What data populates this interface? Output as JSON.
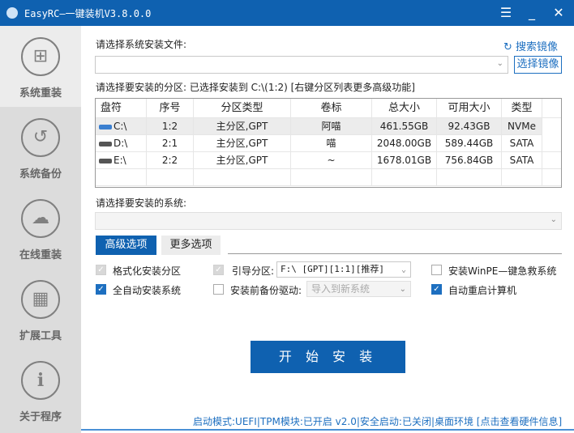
{
  "window": {
    "title": "EasyRC—一键装机V3.8.0.0",
    "menu_icon": "menu-icon",
    "minimize_icon": "minimize-icon",
    "close_icon": "close-icon"
  },
  "sidebar": {
    "items": [
      {
        "label": "系统重装",
        "icon": "windows-icon",
        "active": true
      },
      {
        "label": "系统备份",
        "icon": "backup-icon"
      },
      {
        "label": "在线重装",
        "icon": "cloud-sync-icon"
      },
      {
        "label": "扩展工具",
        "icon": "tools-icon"
      },
      {
        "label": "关于程序",
        "icon": "info-icon"
      }
    ]
  },
  "image": {
    "label": "请选择系统安装文件:",
    "search_label": "搜索镜像",
    "value": "",
    "select_button": "选择镜像"
  },
  "partition": {
    "label": "请选择要安装的分区: 已选择安装到 C:\\(1:2) [右键分区列表更多高级功能]",
    "columns": [
      "盘符",
      "序号",
      "分区类型",
      "卷标",
      "总大小",
      "可用大小",
      "类型"
    ],
    "rows": [
      [
        "C:\\",
        "1:2",
        "主分区,GPT",
        "阿喵",
        "461.55GB",
        "92.43GB",
        "NVMe"
      ],
      [
        "D:\\",
        "2:1",
        "主分区,GPT",
        "喵",
        "2048.00GB",
        "589.44GB",
        "SATA"
      ],
      [
        "E:\\",
        "2:2",
        "主分区,GPT",
        "~",
        "1678.01GB",
        "756.84GB",
        "SATA"
      ]
    ]
  },
  "system": {
    "label": "请选择要安装的系统:",
    "value": ""
  },
  "tabs": [
    "高级选项",
    "更多选项"
  ],
  "options": {
    "format": {
      "label": "格式化安装分区",
      "checked": true,
      "disabled": true
    },
    "boot": {
      "label": "引导分区:",
      "checked": true,
      "disabled": true,
      "value": "F:\\ [GPT][1:1][推荐]"
    },
    "winpe": {
      "label": "安装WinPE—键急救系统",
      "checked": false
    },
    "auto_install": {
      "label": "全自动安装系统",
      "checked": true
    },
    "backup_driver": {
      "label": "安装前备份驱动:",
      "checked": false,
      "value": "导入到新系统"
    },
    "auto_restart": {
      "label": "自动重启计算机",
      "checked": true
    }
  },
  "start_button": "开 始 安 装",
  "status": "启动模式:UEFI|TPM模块:已开启 v2.0|安全启动:已关闭|桌面环境 [点击查看硬件信息]"
}
